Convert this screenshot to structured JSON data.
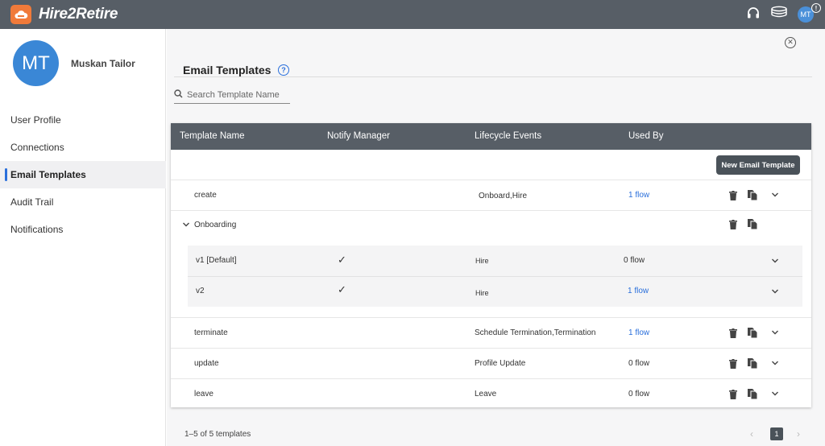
{
  "app": {
    "brand": "Hire2Retire",
    "user_initials": "MT",
    "alert_glyph": "!"
  },
  "user": {
    "initials": "MT",
    "name": "Muskan Tailor"
  },
  "nav": [
    {
      "label": "User Profile"
    },
    {
      "label": "Connections"
    },
    {
      "label": "Email Templates"
    },
    {
      "label": "Audit Trail"
    },
    {
      "label": "Notifications"
    }
  ],
  "page": {
    "title": "Email Templates",
    "search_placeholder": "Search Template Name"
  },
  "table": {
    "headers": {
      "name": "Template Name",
      "notify": "Notify Manager",
      "events": "Lifecycle Events",
      "used": "Used By"
    },
    "new_button": "New Email Template",
    "rows": [
      {
        "name": "create",
        "events": "Onboard,Hire",
        "used": "1 flow"
      },
      {
        "name": "Onboarding",
        "events": "",
        "used": ""
      },
      {
        "name": "terminate",
        "events": "Schedule Termination,Termination",
        "used": "1 flow"
      },
      {
        "name": "update",
        "events": "Profile Update",
        "used": "0 flow"
      },
      {
        "name": "leave",
        "events": "Leave",
        "used": "0 flow"
      }
    ],
    "versions": [
      {
        "name": "v1 [Default]",
        "notify": "✓",
        "events": "Hire",
        "used": "0 flow"
      },
      {
        "name": "v2",
        "notify": "✓",
        "events": "Hire",
        "used": "1 flow"
      }
    ]
  },
  "pagination": {
    "summary": "1–5 of 5 templates",
    "current": "1"
  },
  "colors": {
    "topbar": "#575e66",
    "accent": "#2a6fdb",
    "logo": "#f07a3a"
  }
}
